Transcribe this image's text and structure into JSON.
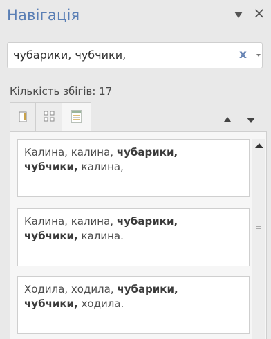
{
  "panel": {
    "title": "Навігація",
    "close_glyph": "×",
    "menu_icon": "triangle-down-icon"
  },
  "search": {
    "value": "чубарики, чубчики,",
    "clear_glyph": "x",
    "dropdown_icon": "dropdown-arrow-icon"
  },
  "matches": {
    "label": "Кількість збігів: 17"
  },
  "tabs": [
    {
      "icon": "page-icon"
    },
    {
      "icon": "thumbnails-icon"
    },
    {
      "icon": "search-results-icon",
      "active": true
    }
  ],
  "results": [
    {
      "plain_before": "Калина, калина, ",
      "bold_1": "чубарики,",
      "bold_2": "чубчики,",
      "plain_after": " калина,"
    },
    {
      "plain_before": "Калина, калина, ",
      "bold_1": "чубарики,",
      "bold_2": "чубчики,",
      "plain_after": " калина."
    },
    {
      "plain_before": "Ходила, ходила, ",
      "bold_1": "чубарики,",
      "bold_2": "чубчики,",
      "plain_after": " ходила."
    }
  ],
  "colors": {
    "title": "#5a7fb5",
    "background": "#e9e9e9",
    "card": "#ffffff"
  }
}
